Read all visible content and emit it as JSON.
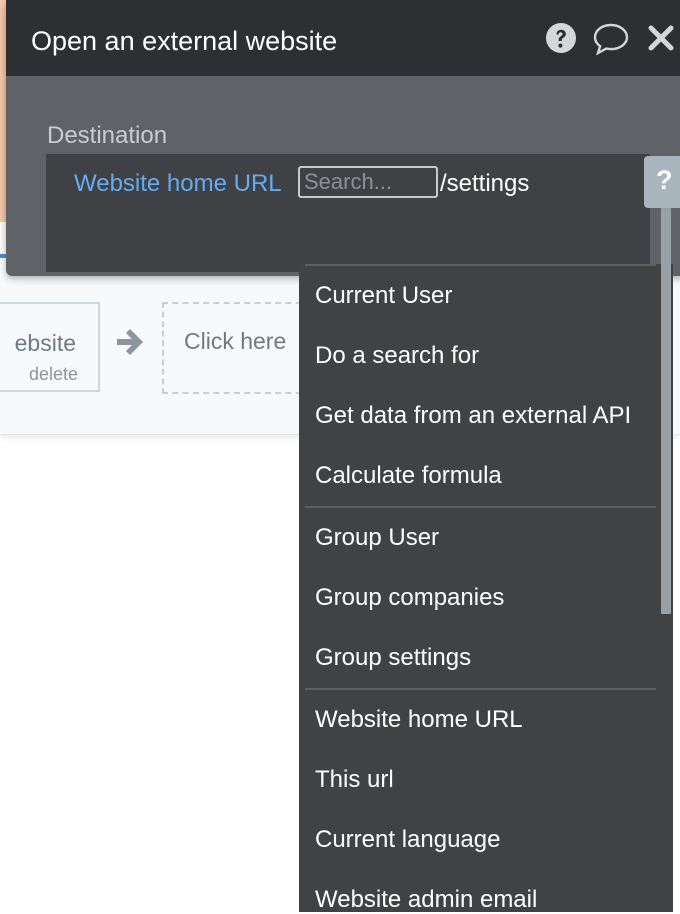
{
  "editor": {
    "title": "Open an external website",
    "destination_label": "Destination",
    "destination": {
      "dynamic_token": "Website home URL",
      "search_placeholder": "Search...",
      "static_suffix": "/settings"
    },
    "side_help": "?"
  },
  "workflow": {
    "action_title": "Open an external website",
    "action_title_visible": "ebsite",
    "delete_label": "delete",
    "click_here_label": "Click here"
  },
  "dropdown": {
    "groups": [
      [
        "Current User",
        "Do a search for",
        "Get data from an external API",
        "Calculate formula"
      ],
      [
        "Group User",
        "Group companies",
        "Group settings"
      ],
      [
        "Website home URL",
        "This url",
        "Current language",
        "Website admin email"
      ]
    ]
  },
  "colors": {
    "editor_header": "#2c3033",
    "editor_body": "#5f6367",
    "field_bg": "#3f4144",
    "dynamic_token": "#62adf0",
    "dropdown_bg": "#414243"
  }
}
